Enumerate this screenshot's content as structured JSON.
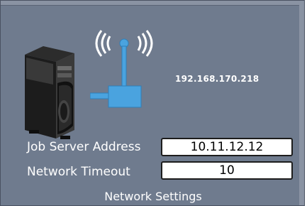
{
  "device": {
    "ip_address": "192.168.170.218",
    "tower_icon": "pc-tower-icon",
    "network_icon": "wireless-antenna-icon"
  },
  "form": {
    "job_server": {
      "label": "Job Server Address",
      "value": "10.11.12.12"
    },
    "timeout": {
      "label": "Network Timeout",
      "value": "10"
    }
  },
  "footer": {
    "title": "Network Settings"
  },
  "colors": {
    "panel_background": "#6f7b8e",
    "network_blue": "#4aa3df",
    "text": "#ffffff",
    "field_background": "#ffffff"
  }
}
